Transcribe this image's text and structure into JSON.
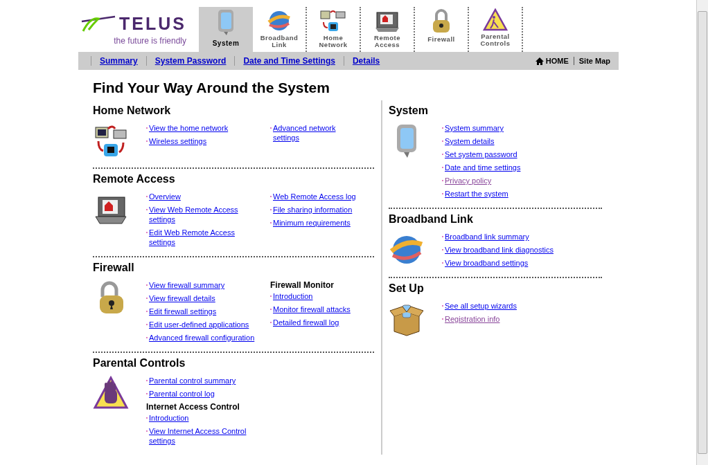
{
  "brand": {
    "name": "TELUS",
    "tagline": "the future is friendly"
  },
  "tabs": [
    {
      "label": "System",
      "selected": true
    },
    {
      "label": "Broadband Link",
      "selected": false
    },
    {
      "label": "Home Network",
      "selected": false
    },
    {
      "label": "Remote Access",
      "selected": false
    },
    {
      "label": "Firewall",
      "selected": false
    },
    {
      "label": "Parental Controls",
      "selected": false
    }
  ],
  "subnav": {
    "links": [
      "Summary",
      "System Password",
      "Date and Time Settings",
      "Details"
    ],
    "home": "HOME",
    "sitemap": "Site Map"
  },
  "page_title": "Find Your Way Around the System",
  "left_sections": [
    {
      "title": "Home Network",
      "columns": [
        [
          {
            "kind": "link",
            "text": "View the home network",
            "visited": false
          },
          {
            "kind": "link",
            "text": "Wireless settings",
            "visited": false
          }
        ],
        [
          {
            "kind": "link",
            "text": "Advanced network settings",
            "visited": false
          }
        ]
      ]
    },
    {
      "title": "Remote Access",
      "columns": [
        [
          {
            "kind": "link",
            "text": "Overview",
            "visited": false
          },
          {
            "kind": "link",
            "text": "View Web Remote Access settings",
            "visited": false
          },
          {
            "kind": "link",
            "text": "Edit Web Remote Access settings",
            "visited": false
          }
        ],
        [
          {
            "kind": "link",
            "text": "Web Remote Access log",
            "visited": false
          },
          {
            "kind": "link",
            "text": "File sharing information",
            "visited": false
          },
          {
            "kind": "link",
            "text": "Minimum requirements",
            "visited": false
          }
        ]
      ]
    },
    {
      "title": "Firewall",
      "columns": [
        [
          {
            "kind": "link",
            "text": "View  firewall summary",
            "visited": false
          },
          {
            "kind": "link",
            "text": "View  firewall details",
            "visited": false
          },
          {
            "kind": "link",
            "text": "Edit firewall settings",
            "visited": false
          },
          {
            "kind": "link",
            "text": "Edit user-defined applications",
            "visited": false
          },
          {
            "kind": "link",
            "text": "Advanced firewall configuration",
            "visited": false
          }
        ],
        [
          {
            "kind": "heading",
            "text": "Firewall Monitor"
          },
          {
            "kind": "link",
            "text": "Introduction",
            "visited": false
          },
          {
            "kind": "link",
            "text": "Monitor firewall attacks",
            "visited": false
          },
          {
            "kind": "link",
            "text": "Detailed firewall log",
            "visited": false
          }
        ]
      ]
    },
    {
      "title": "Parental Controls",
      "columns": [
        [
          {
            "kind": "link",
            "text": "Parental control summary",
            "visited": false
          },
          {
            "kind": "link",
            "text": "Parental control log",
            "visited": false
          },
          {
            "kind": "heading",
            "text": "Internet Access Control"
          },
          {
            "kind": "link",
            "text": "Introduction",
            "visited": false
          },
          {
            "kind": "link",
            "text": "View Internet Access Control settings",
            "visited": false
          }
        ]
      ]
    }
  ],
  "right_sections": [
    {
      "title": "System",
      "columns": [
        [
          {
            "kind": "link",
            "text": "System summary",
            "visited": false
          },
          {
            "kind": "link",
            "text": "System details",
            "visited": false
          },
          {
            "kind": "link",
            "text": "Set system password",
            "visited": false
          },
          {
            "kind": "link",
            "text": "Date and time settings",
            "visited": false
          },
          {
            "kind": "link",
            "text": "Privacy policy",
            "visited": true
          },
          {
            "kind": "link",
            "text": "Restart the system",
            "visited": false
          }
        ]
      ]
    },
    {
      "title": "Broadband Link",
      "columns": [
        [
          {
            "kind": "link",
            "text": "Broadband link summary",
            "visited": false
          },
          {
            "kind": "link",
            "text": "View broadband link diagnostics",
            "visited": false
          },
          {
            "kind": "link",
            "text": "View broadband settings",
            "visited": false
          }
        ]
      ]
    },
    {
      "title": "Set Up",
      "columns": [
        [
          {
            "kind": "link",
            "text": "See all setup wizards",
            "visited": false
          },
          {
            "kind": "link",
            "text": "Registration info",
            "visited": true
          }
        ]
      ]
    }
  ]
}
